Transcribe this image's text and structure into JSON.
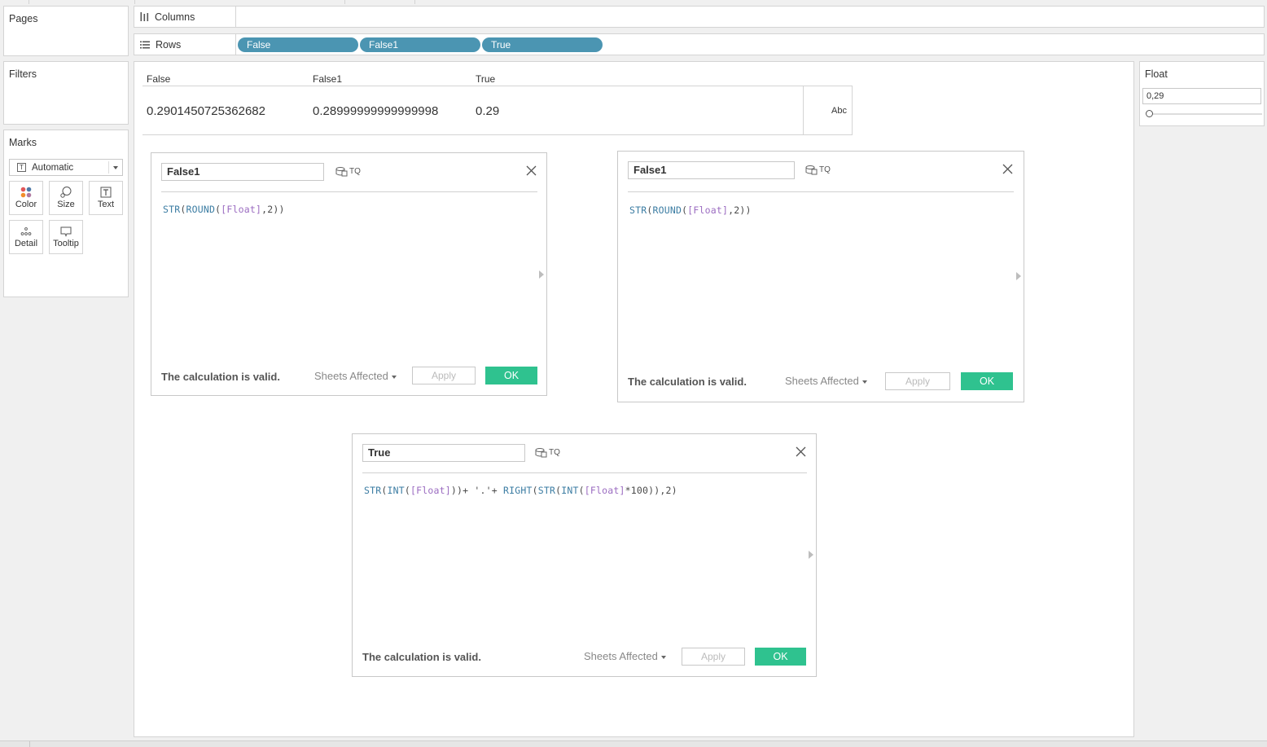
{
  "pages_card": {
    "title": "Pages"
  },
  "filters_card": {
    "title": "Filters"
  },
  "marks_card": {
    "title": "Marks",
    "mark_type": "Automatic",
    "buttons": [
      "Color",
      "Size",
      "Text",
      "Detail",
      "Tooltip"
    ]
  },
  "columns_shelf": {
    "label": "Columns"
  },
  "rows_shelf": {
    "label": "Rows",
    "pills": [
      "False",
      "False1",
      "True"
    ]
  },
  "table": {
    "headers": [
      "False",
      "False1",
      "True"
    ],
    "values": [
      "0.2901450725362682",
      "0.28999999999999998",
      "0.29"
    ],
    "abc_label": "Abc"
  },
  "dialogs": [
    {
      "name": "False1",
      "datasource": "TQ",
      "formula": [
        {
          "t": "STR",
          "k": "fn"
        },
        {
          "t": "(",
          "k": "p"
        },
        {
          "t": "ROUND",
          "k": "fn"
        },
        {
          "t": "(",
          "k": "p"
        },
        {
          "t": "[Float]",
          "k": "fld"
        },
        {
          "t": ",2))",
          "k": "p"
        }
      ],
      "status": "The calculation is valid.",
      "sheets_label": "Sheets Affected",
      "apply_label": "Apply",
      "ok_label": "OK"
    },
    {
      "name": "False1",
      "datasource": "TQ",
      "formula": [
        {
          "t": "STR",
          "k": "fn"
        },
        {
          "t": "(",
          "k": "p"
        },
        {
          "t": "ROUND",
          "k": "fn"
        },
        {
          "t": "(",
          "k": "p"
        },
        {
          "t": "[Float]",
          "k": "fld"
        },
        {
          "t": ",2))",
          "k": "p"
        }
      ],
      "status": "The calculation is valid.",
      "sheets_label": "Sheets Affected",
      "apply_label": "Apply",
      "ok_label": "OK"
    },
    {
      "name": "True",
      "datasource": "TQ",
      "formula": [
        {
          "t": "STR",
          "k": "fn"
        },
        {
          "t": "(",
          "k": "p"
        },
        {
          "t": "INT",
          "k": "fn"
        },
        {
          "t": "(",
          "k": "p"
        },
        {
          "t": "[Float]",
          "k": "fld"
        },
        {
          "t": "))+ '.'+ ",
          "k": "p"
        },
        {
          "t": "RIGHT",
          "k": "fn"
        },
        {
          "t": "(",
          "k": "p"
        },
        {
          "t": "STR",
          "k": "fn"
        },
        {
          "t": "(",
          "k": "p"
        },
        {
          "t": "INT",
          "k": "fn"
        },
        {
          "t": "(",
          "k": "p"
        },
        {
          "t": "[Float]",
          "k": "fld"
        },
        {
          "t": "*100)),2)",
          "k": "p"
        }
      ],
      "status": "The calculation is valid.",
      "sheets_label": "Sheets Affected",
      "apply_label": "Apply",
      "ok_label": "OK"
    }
  ],
  "parameter": {
    "title": "Float",
    "value": "0,29"
  },
  "colors": {
    "pill": "#4b95b2",
    "ok": "#2fc28f",
    "function": "#3c7da3",
    "field": "#9b6cc1"
  }
}
